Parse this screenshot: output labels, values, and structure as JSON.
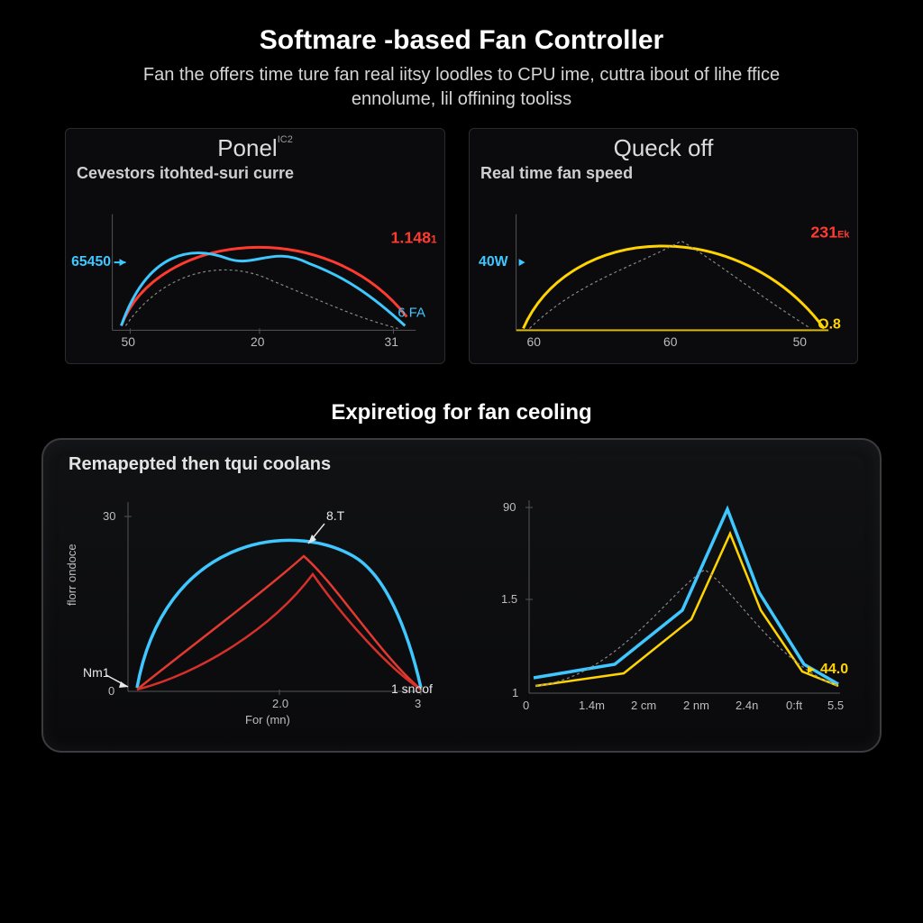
{
  "header": {
    "title": "Softmare -based Fan Controller",
    "subtitle": "Fan the offers time ture fan real iitsy loodles to CPU ime, cuttra ibout of lihe ffice ennolume, lil offining tooliss"
  },
  "panel1": {
    "title": "Ponel",
    "sup": "IC2",
    "label": "Cevestors itohted-suri curre",
    "value_red": "1.148",
    "value_red_unit": "1",
    "value_cyan_left": "65450",
    "value_cyan_right": "6 FA",
    "x_ticks": [
      "50",
      "20",
      "31"
    ]
  },
  "panel2": {
    "title": "Queck off",
    "label": "Real time fan speed",
    "value_red": "231",
    "value_red_unit": "Ek",
    "value_cyan_left": "40W",
    "value_yel_right": "O.8",
    "x_ticks": [
      "60",
      "60",
      "50"
    ]
  },
  "section2_title": "Expiretiog for fan ceoling",
  "big_label": "Remapepted then tqui coolans",
  "sub1": {
    "y_ticks": [
      "30",
      "0"
    ],
    "y_label": "florr ondoce",
    "xlabel": "For (mn)",
    "x_ticks": [
      "2.0",
      "3"
    ],
    "ann_top": "8.T",
    "ann_left": "Nm1",
    "ann_right": "1 snoof"
  },
  "sub2": {
    "y_ticks": [
      "90",
      "1.5",
      "1"
    ],
    "x_ticks": [
      "0",
      "1.4m",
      "2 cm",
      "2 nm",
      "2.4n",
      "0:ft",
      "5.5"
    ],
    "value_yel": "44.0"
  },
  "chart_data": [
    {
      "type": "line",
      "title": "Ponel — Cevestors itohted-suri curre",
      "x_ticks": [
        50,
        20,
        31
      ],
      "ylim": [
        0,
        1.2
      ],
      "series": [
        {
          "name": "red",
          "color": "#ff3b30",
          "annotation": "1.148",
          "x": [
            0,
            0.1,
            0.25,
            0.45,
            0.65,
            0.85,
            1.0
          ],
          "y": [
            0.05,
            0.55,
            0.9,
            1.0,
            0.92,
            0.6,
            0.1
          ]
        },
        {
          "name": "cyan",
          "color": "#3fc8ff",
          "left_annotation": "65450",
          "right_annotation": "6 FA",
          "x": [
            0,
            0.1,
            0.25,
            0.4,
            0.55,
            0.7,
            0.85,
            1.0
          ],
          "y": [
            0.05,
            0.55,
            0.8,
            0.78,
            0.86,
            0.72,
            0.55,
            0.1
          ]
        },
        {
          "name": "dashed",
          "color": "#888",
          "x": [
            0.05,
            0.2,
            0.35,
            0.5,
            0.65,
            0.8,
            0.95
          ],
          "y": [
            0.05,
            0.5,
            0.7,
            0.6,
            0.45,
            0.3,
            0.1
          ]
        }
      ]
    },
    {
      "type": "line",
      "title": "Queck off — Real time fan speed",
      "x_ticks": [
        60,
        60,
        50
      ],
      "ylim": [
        0,
        1.0
      ],
      "series": [
        {
          "name": "yellow",
          "color": "#ffd400",
          "annotation": "O.8",
          "x": [
            0,
            0.1,
            0.3,
            0.5,
            0.7,
            0.9,
            1.0
          ],
          "y": [
            0.02,
            0.45,
            0.85,
            0.95,
            0.88,
            0.5,
            0.05
          ]
        },
        {
          "name": "red-callout",
          "color": "#ff3b30",
          "annotation": "231",
          "x": [
            1.0
          ],
          "y": [
            0.75
          ]
        },
        {
          "name": "dashed",
          "color": "#888",
          "x": [
            0.05,
            0.25,
            0.45,
            0.6,
            0.75,
            0.9
          ],
          "y": [
            0.05,
            0.35,
            0.55,
            0.75,
            0.55,
            0.1
          ]
        },
        {
          "name": "cyan-marker",
          "color": "#3fc8ff",
          "annotation": "40W",
          "x": [
            0.0
          ],
          "y": [
            0.45
          ]
        }
      ]
    },
    {
      "type": "line",
      "title": "Remapepted then tqui coolans (left)",
      "xlabel": "For (mn)",
      "ylabel": "florr ondoce",
      "x_ticks": [
        2.0,
        3
      ],
      "y_ticks": [
        0,
        30
      ],
      "series": [
        {
          "name": "cyan",
          "color": "#3fc8ff",
          "x": [
            0,
            0.15,
            0.35,
            0.55,
            0.75,
            0.95,
            1.0
          ],
          "y": [
            2,
            22,
            29,
            29,
            26,
            16,
            3
          ]
        },
        {
          "name": "red1",
          "color": "#e03a2f",
          "x": [
            0,
            0.2,
            0.4,
            0.55,
            0.7,
            0.9,
            1.0
          ],
          "y": [
            1,
            10,
            20,
            25,
            20,
            8,
            1
          ]
        },
        {
          "name": "red2",
          "color": "#d8302a",
          "x": [
            0,
            0.25,
            0.45,
            0.6,
            0.78,
            1.0
          ],
          "y": [
            1,
            5,
            15,
            22,
            12,
            1
          ]
        }
      ],
      "annotations": [
        "8.T",
        "Nm1",
        "1 snoof"
      ]
    },
    {
      "type": "line",
      "title": "Remapepted then tqui coolans (right)",
      "x_ticks": [
        0,
        1.4,
        2,
        2,
        2.4,
        0,
        5.5
      ],
      "y_ticks": [
        1,
        1.5,
        90
      ],
      "series": [
        {
          "name": "cyan",
          "color": "#3fc8ff",
          "x": [
            0,
            1.5,
            2.5,
            3.3,
            3.8,
            4.5,
            5.5
          ],
          "y": [
            5,
            8,
            20,
            88,
            40,
            12,
            5
          ]
        },
        {
          "name": "yellow",
          "color": "#ffd400",
          "annotation": "44.0",
          "x": [
            0,
            1.8,
            2.8,
            3.5,
            4.0,
            4.6,
            5.5
          ],
          "y": [
            3,
            6,
            18,
            75,
            30,
            10,
            4
          ]
        },
        {
          "name": "dashed",
          "color": "#888",
          "x": [
            0,
            1.6,
            2.6,
            3.2,
            3.9,
            4.7,
            5.5
          ],
          "y": [
            3,
            5,
            30,
            45,
            25,
            8,
            3
          ]
        }
      ]
    }
  ]
}
